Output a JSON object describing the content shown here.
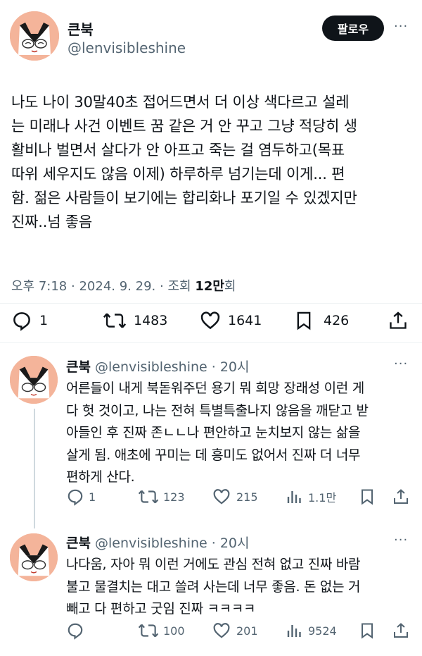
{
  "main_tweet": {
    "display_name": "큰북",
    "handle": "@lenvisibleshine",
    "follow_label": "팔로우",
    "more": "···",
    "text": "나도 나이 30말40초 접어드면서 더 이상 색다르고 설레\n는 미래나 사건 이벤트 꿈 같은 거 안 꾸고 그냥 적당히 생\n활비나 벌면서 살다가 안 아프고 죽는 걸  염두하고(목표\n따위 세우지도 않음 이제) 하루하루 넘기는데 이게... 편\n함. 젊은 사람들이 보기에는 합리화나 포기일 수 있겠지만\n진짜..넘 좋음",
    "time": "오후 7:18",
    "date": "2024. 9. 29.",
    "views_label": "조회",
    "views": "12만",
    "sep": "·",
    "stats": {
      "replies": "1",
      "retweets": "1483",
      "likes": "1641",
      "bookmarks": "426"
    }
  },
  "replies": [
    {
      "display_name": "큰북",
      "handle": "@lenvisibleshine",
      "age": "· 20시",
      "text": "어른들이 내게 북돋워주던 용기 뭐 희망 장래성 이런 게\n다 헛 것이고, 나는 전혀 특별특출나지 않음을 깨닫고 받\n아들인 후 진짜 존ㄴㄴ나 편안하고 눈치보지 않는 삶을\n살게 됨. 애초에 꾸미는 데 흥미도 없어서 진짜 더 너무\n편하게 산다.",
      "stats": {
        "replies": "1",
        "retweets": "123",
        "likes": "215",
        "views": "1.1만"
      }
    },
    {
      "display_name": "큰북",
      "handle": "@lenvisibleshine",
      "age": "· 20시",
      "text": "나다움, 자아 뭐 이런 거에도 관심 전혀 없고 진짜 바람\n불고 물결치는 대고 쓸려 사는데 너무 좋음. 돈 없는 거\n빼고 다 편하고 굿임 진짜 ㅋㅋㅋㅋ",
      "stats": {
        "replies": "",
        "retweets": "100",
        "likes": "201",
        "views": "9524"
      }
    }
  ],
  "colors": {
    "accent": "#0f1419",
    "muted": "#536471",
    "avatar_bg": "#f4b49a"
  },
  "icons": [
    "reply-icon",
    "retweet-icon",
    "like-icon",
    "bookmark-icon",
    "share-icon",
    "views-icon",
    "more-icon"
  ]
}
